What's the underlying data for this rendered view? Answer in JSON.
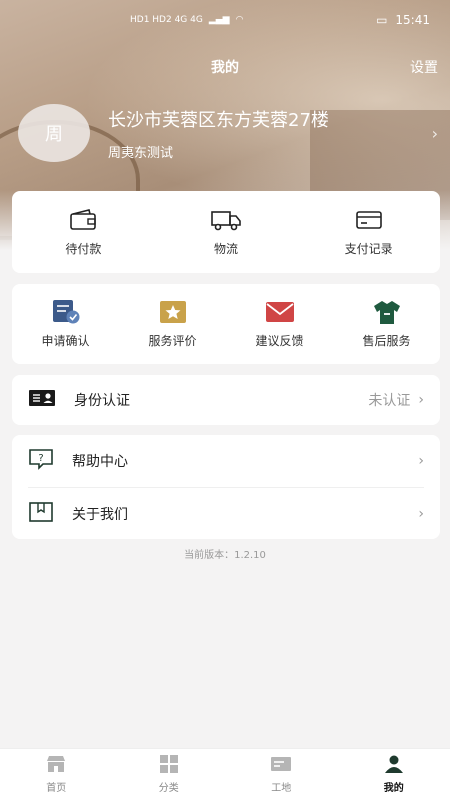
{
  "status_bar": {
    "network_left": "HD1 HD2 4G 4G",
    "time": "15:41"
  },
  "nav": {
    "title": "我的",
    "settings": "设置"
  },
  "profile": {
    "avatar_char": "周",
    "address": "长沙市芙蓉区东方芙蓉27楼",
    "name": "周夷东测试"
  },
  "orders": [
    {
      "label": "待付款",
      "icon": "wallet-icon"
    },
    {
      "label": "物流",
      "icon": "truck-icon"
    },
    {
      "label": "支付记录",
      "icon": "card-icon"
    }
  ],
  "services": [
    {
      "label": "申请确认",
      "icon": "apply-check-icon",
      "color": "#3c5a8a"
    },
    {
      "label": "服务评价",
      "icon": "star-rating-icon",
      "color": "#c9a24a"
    },
    {
      "label": "建议反馈",
      "icon": "mail-icon",
      "color": "#d04545"
    },
    {
      "label": "售后服务",
      "icon": "service-shirt-icon",
      "color": "#1f5a3f"
    }
  ],
  "identity": {
    "label": "身份认证",
    "status": "未认证"
  },
  "help_list": [
    {
      "label": "帮助中心"
    },
    {
      "label": "关于我们"
    }
  ],
  "version": "当前版本：1.2.10",
  "tabs": [
    {
      "label": "首页",
      "icon": "home-store-icon"
    },
    {
      "label": "分类",
      "icon": "grid-icon"
    },
    {
      "label": "工地",
      "icon": "site-card-icon"
    },
    {
      "label": "我的",
      "icon": "person-icon"
    }
  ],
  "colors": {
    "accent": "#1f3a2e",
    "muted": "#999999"
  }
}
